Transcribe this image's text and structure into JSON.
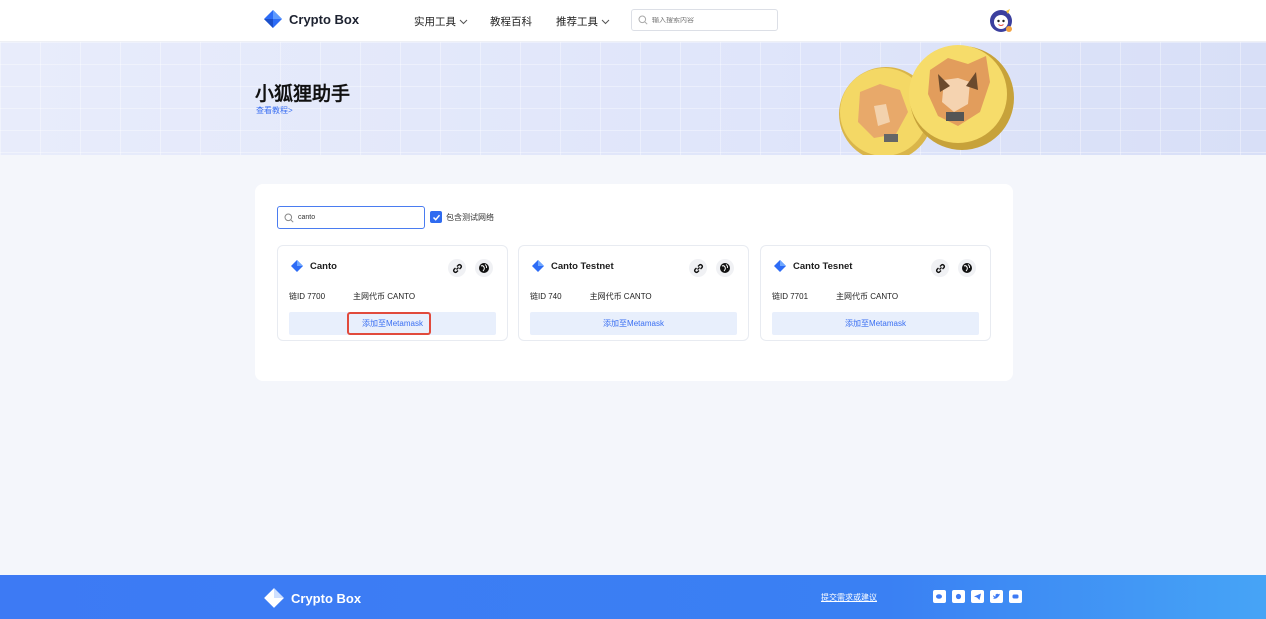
{
  "header": {
    "brand": "Crypto Box",
    "nav": [
      {
        "label": "实用工具",
        "has_dropdown": true
      },
      {
        "label": "教程百科",
        "has_dropdown": false
      },
      {
        "label": "推荐工具",
        "has_dropdown": true
      }
    ],
    "search_placeholder": "输入搜索内容"
  },
  "banner": {
    "title": "小狐狸助手",
    "link": "查看教程>"
  },
  "filter": {
    "search_value": "canto",
    "include_testnet_label": "包含测试网络",
    "include_testnet_checked": true
  },
  "cards": [
    {
      "name": "Canto",
      "chain_id": "链ID 7700",
      "token": "主网代币 CANTO",
      "button": "添加至Metamask"
    },
    {
      "name": "Canto Testnet",
      "chain_id": "链ID 740",
      "token": "主网代币 CANTO",
      "button": "添加至Metamask"
    },
    {
      "name": "Canto Tesnet",
      "chain_id": "链ID 7701",
      "token": "主网代币 CANTO",
      "button": "添加至Metamask"
    }
  ],
  "footer": {
    "brand": "Crypto Box",
    "link": "提交需求或建议",
    "socials": [
      "wechat-icon",
      "weibo-icon",
      "telegram-icon",
      "twitter-icon",
      "discord-icon"
    ]
  },
  "colors": {
    "accent": "#3a6ff2",
    "highlight": "#e14a3c",
    "footer": "#3d7af4"
  }
}
